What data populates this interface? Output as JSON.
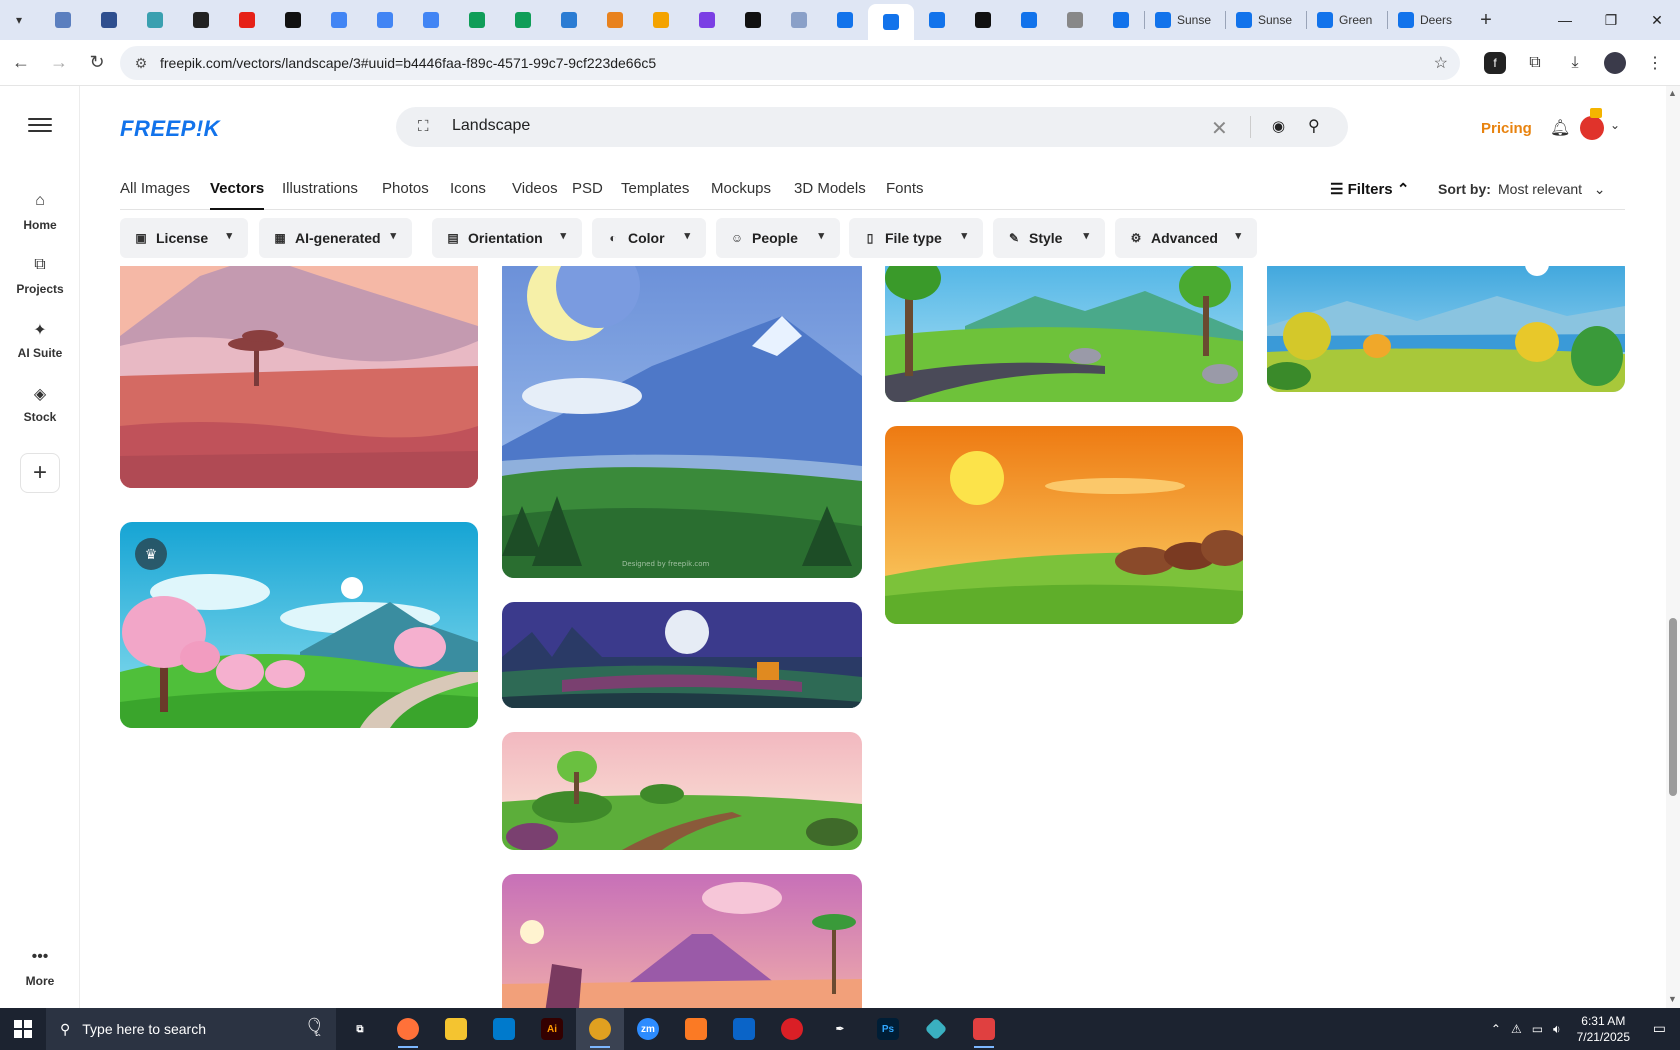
{
  "browser": {
    "tabs": [
      {
        "icon": "globe-icon",
        "color": "#5b7fbf",
        "title": ""
      },
      {
        "icon": "vpn-icon",
        "color": "#2f4f8f",
        "title": ""
      },
      {
        "icon": "hexagon-icon",
        "color": "#3aa0b0",
        "title": ""
      },
      {
        "icon": "openai-icon",
        "color": "#222222",
        "title": ""
      },
      {
        "icon": "youtube-icon",
        "color": "#e62117",
        "title": ""
      },
      {
        "icon": "bolt-icon",
        "color": "#111111",
        "title": ""
      },
      {
        "icon": "docs-icon",
        "color": "#4285f4",
        "title": ""
      },
      {
        "icon": "docs-icon",
        "color": "#4285f4",
        "title": ""
      },
      {
        "icon": "docs-icon",
        "color": "#4285f4",
        "title": ""
      },
      {
        "icon": "sheets-icon",
        "color": "#0f9d58",
        "title": ""
      },
      {
        "icon": "sheets-icon",
        "color": "#0f9d58",
        "title": ""
      },
      {
        "icon": "word-icon",
        "color": "#2b7cd3",
        "title": ""
      },
      {
        "icon": "box-icon",
        "color": "#e8821e",
        "title": ""
      },
      {
        "icon": "crown-icon",
        "color": "#f4a300",
        "title": ""
      },
      {
        "icon": "braces-icon",
        "color": "#7b3fe4",
        "title": ""
      },
      {
        "icon": "ai-icon",
        "color": "#111111",
        "title": ""
      },
      {
        "icon": "grid-icon",
        "color": "#8aa0c8",
        "title": ""
      },
      {
        "icon": "freepik-icon",
        "color": "#1273eb",
        "title": ""
      },
      {
        "icon": "freepik-icon",
        "color": "#1273eb",
        "title": "",
        "active": true
      },
      {
        "icon": "freepik-icon",
        "color": "#1273eb",
        "title": ""
      },
      {
        "icon": "m-icon",
        "color": "#111111",
        "title": ""
      },
      {
        "icon": "freepik-icon",
        "color": "#1273eb",
        "title": ""
      },
      {
        "icon": "circle-icon",
        "color": "#888888",
        "title": ""
      },
      {
        "icon": "freepik-icon",
        "color": "#1273eb",
        "title": ""
      }
    ],
    "named_tabs": [
      {
        "icon": "freepik-icon",
        "title": "Sunse"
      },
      {
        "icon": "freepik-icon",
        "title": "Sunse"
      },
      {
        "icon": "freepik-icon",
        "title": "Green"
      },
      {
        "icon": "freepik-icon",
        "title": "Deers"
      }
    ],
    "new_tab": "+",
    "url": "freepik.com/vectors/landscape/3#uuid=b4446faa-f89c-4571-99c7-9cf223de66c5"
  },
  "site": {
    "logo": "FREEP!K",
    "search_value": "Landscape",
    "pricing": "Pricing",
    "sidebar": [
      {
        "label": "Home",
        "icon": "home-icon"
      },
      {
        "label": "Projects",
        "icon": "projects-icon"
      },
      {
        "label": "AI Suite",
        "icon": "sparkle-icon"
      },
      {
        "label": "Stock",
        "icon": "stock-icon"
      }
    ],
    "more": "More",
    "categories": [
      "All Images",
      "Vectors",
      "Illustrations",
      "Photos",
      "Icons",
      "Videos",
      "PSD",
      "Templates",
      "Mockups",
      "3D Models",
      "Fonts"
    ],
    "active_category": "Vectors",
    "filters_label": "Filters",
    "sort_label": "Sort by:",
    "sort_value": "Most relevant",
    "filter_buttons": [
      "License",
      "AI-generated",
      "Orientation",
      "Color",
      "People",
      "File type",
      "Style",
      "Advanced"
    ],
    "watermark": "Designed by freepik.com"
  },
  "taskbar": {
    "search_placeholder": "Type here to search",
    "time": "6:31 AM",
    "date": "7/21/2025"
  }
}
